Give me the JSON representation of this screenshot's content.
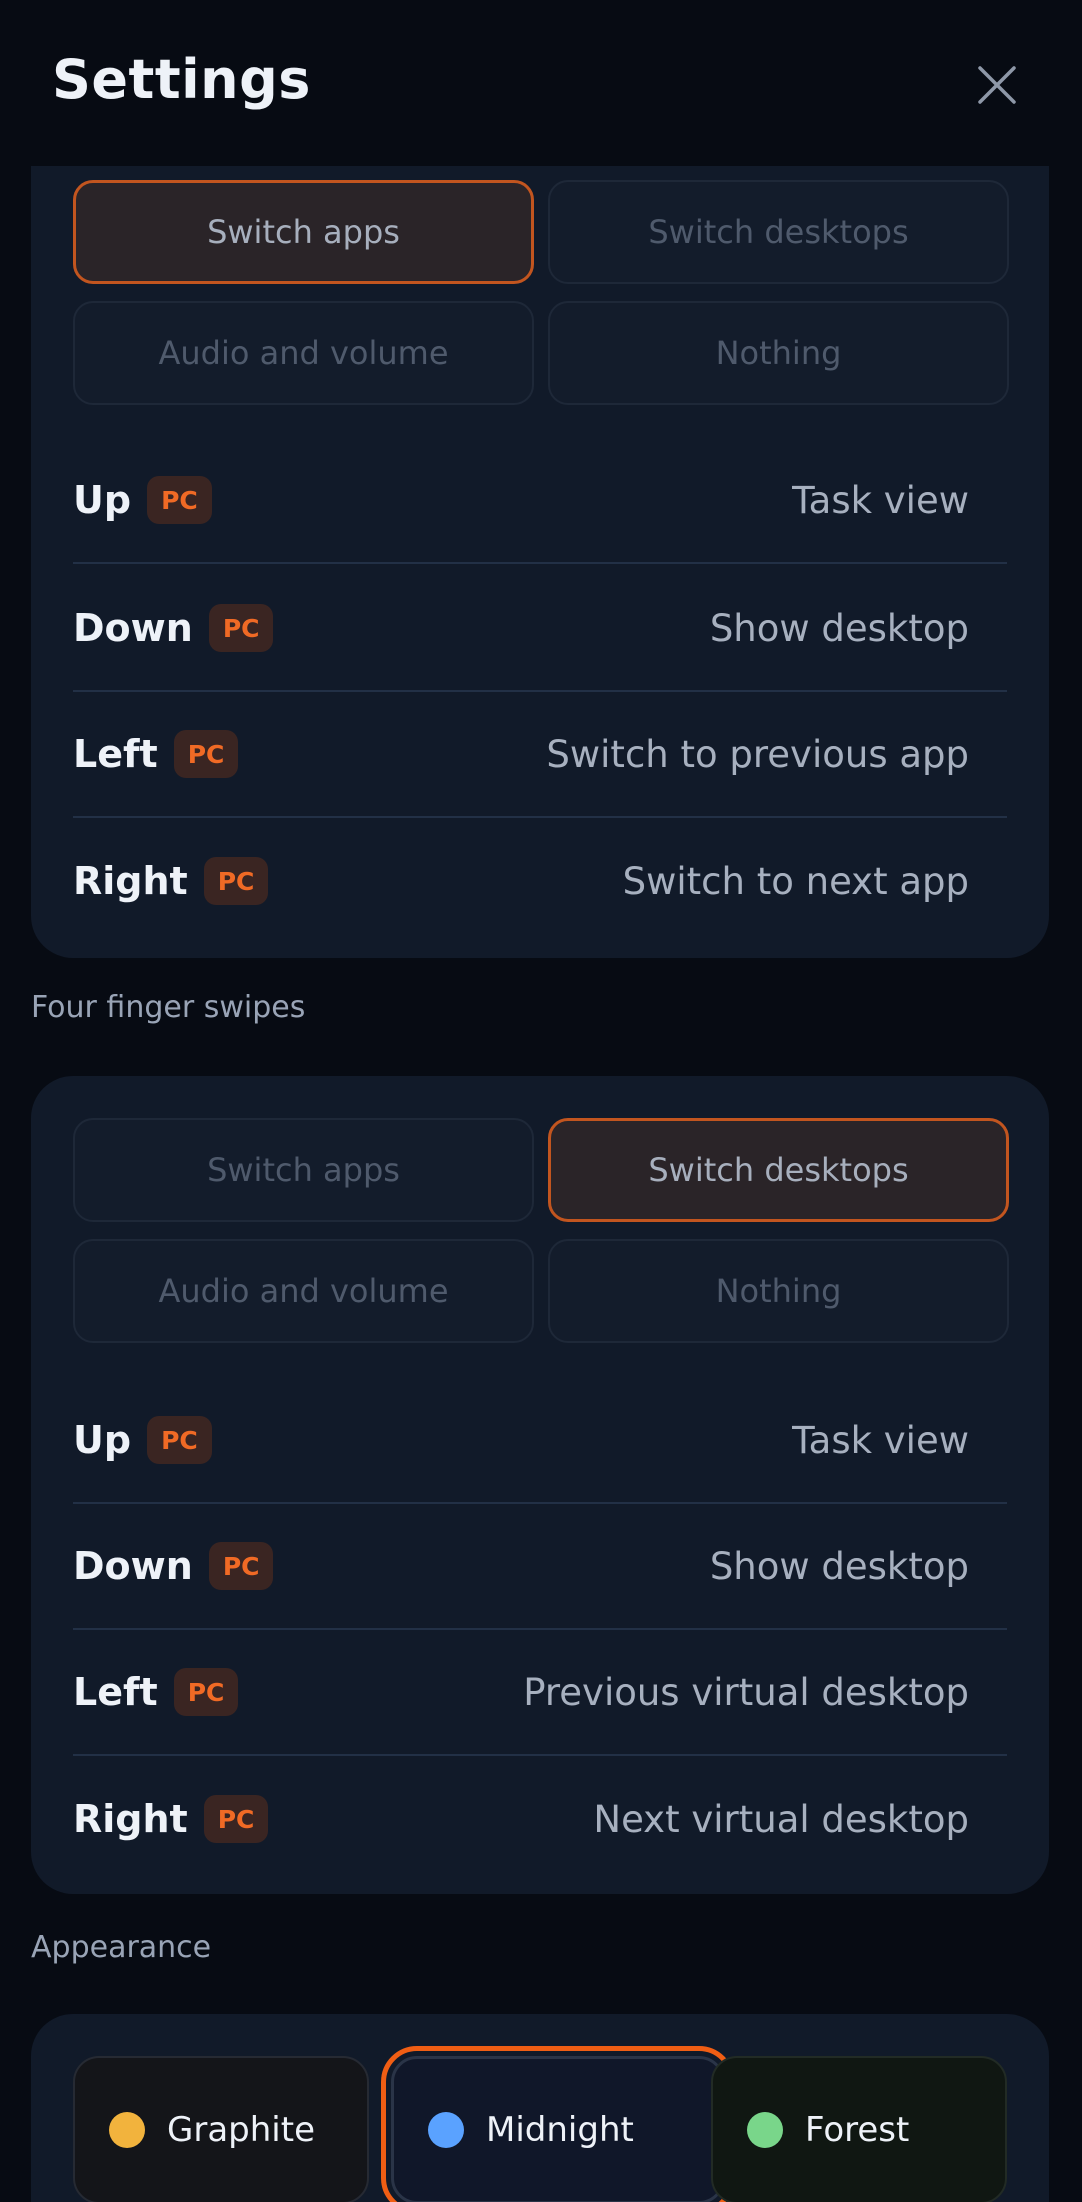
{
  "header": {
    "title": "Settings"
  },
  "three_finger": {
    "options": [
      "Switch apps",
      "Switch desktops",
      "Audio and volume",
      "Nothing"
    ],
    "selected": "Switch apps",
    "rows": [
      {
        "name": "Up",
        "badge": "PC",
        "value": "Task view"
      },
      {
        "name": "Down",
        "badge": "PC",
        "value": "Show desktop"
      },
      {
        "name": "Left",
        "badge": "PC",
        "value": "Switch to previous app"
      },
      {
        "name": "Right",
        "badge": "PC",
        "value": "Switch to next app"
      }
    ]
  },
  "four_finger": {
    "label": "Four finger swipes",
    "options": [
      "Switch apps",
      "Switch desktops",
      "Audio and volume",
      "Nothing"
    ],
    "selected": "Switch desktops",
    "rows": [
      {
        "name": "Up",
        "badge": "PC",
        "value": "Task view"
      },
      {
        "name": "Down",
        "badge": "PC",
        "value": "Show desktop"
      },
      {
        "name": "Left",
        "badge": "PC",
        "value": "Previous virtual desktop"
      },
      {
        "name": "Right",
        "badge": "PC",
        "value": "Next virtual desktop"
      }
    ]
  },
  "appearance": {
    "label": "Appearance",
    "themes": [
      {
        "name": "Graphite",
        "color": "#f2b33d"
      },
      {
        "name": "Midnight",
        "color": "#5aa2ff"
      },
      {
        "name": "Forest",
        "color": "#79d68a"
      }
    ],
    "selected": "Midnight"
  },
  "colors": {
    "accent": "#f05e14",
    "background": "#070b13",
    "card": "#111a29"
  }
}
